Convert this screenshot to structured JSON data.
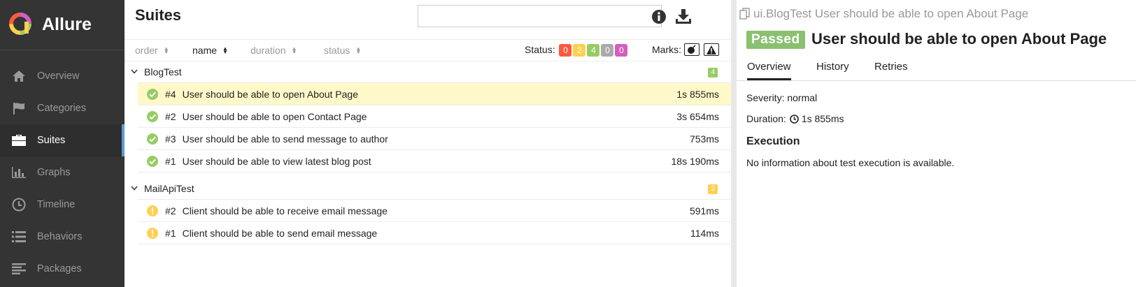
{
  "app": {
    "name": "Allure"
  },
  "sidebar": {
    "items": [
      {
        "label": "Overview",
        "icon": "home-icon"
      },
      {
        "label": "Categories",
        "icon": "flag-icon"
      },
      {
        "label": "Suites",
        "icon": "briefcase-icon",
        "active": true
      },
      {
        "label": "Graphs",
        "icon": "bar-chart-icon"
      },
      {
        "label": "Timeline",
        "icon": "clock-icon"
      },
      {
        "label": "Behaviors",
        "icon": "list-icon"
      },
      {
        "label": "Packages",
        "icon": "align-left-icon"
      }
    ]
  },
  "suites": {
    "title": "Suites",
    "search": {
      "value": "",
      "placeholder": ""
    },
    "sort": {
      "order": "order",
      "name": "name",
      "duration": "duration",
      "status": "status"
    },
    "status_label": "Status:",
    "status_counts": [
      {
        "value": "0",
        "color": "#fd5a3e"
      },
      {
        "value": "2",
        "color": "#ffd050"
      },
      {
        "value": "4",
        "color": "#97cc64"
      },
      {
        "value": "0",
        "color": "#aaaaaa"
      },
      {
        "value": "0",
        "color": "#d35ebe"
      }
    ],
    "marks_label": "Marks:",
    "groups": [
      {
        "name": "BlogTest",
        "count": "4",
        "count_color": "#97cc64",
        "rows": [
          {
            "num": "#4",
            "name": "User should be able to open About Page",
            "duration": "1s 855ms",
            "status": "passed",
            "selected": true
          },
          {
            "num": "#2",
            "name": "User should be able to open Contact Page",
            "duration": "3s 654ms",
            "status": "passed"
          },
          {
            "num": "#3",
            "name": "User should be able to send message to author",
            "duration": "753ms",
            "status": "passed"
          },
          {
            "num": "#1",
            "name": "User should be able to view latest blog post",
            "duration": "18s 190ms",
            "status": "passed"
          }
        ]
      },
      {
        "name": "MailApiTest",
        "count": "2",
        "count_color": "#ffd050",
        "rows": [
          {
            "num": "#2",
            "name": "Client should be able to receive email message",
            "duration": "591ms",
            "status": "broken"
          },
          {
            "num": "#1",
            "name": "Client should be able to send email message",
            "duration": "114ms",
            "status": "broken"
          }
        ]
      }
    ]
  },
  "detail": {
    "breadcrumb": "ui.BlogTest User should be able to open About Page",
    "status_badge": "Passed",
    "title": "User should be able to open About Page",
    "tabs": [
      "Overview",
      "History",
      "Retries"
    ],
    "severity": "Severity: normal",
    "duration_label": "Duration:",
    "duration_value": "1s 855ms",
    "execution_heading": "Execution",
    "execution_text": "No information about test execution is available."
  },
  "colors": {
    "passed": "#97cc64",
    "broken": "#ffd050",
    "sidebar_bg": "#343434",
    "active_indicator": "#5b9bd5",
    "selected_row": "#fff9c9"
  }
}
